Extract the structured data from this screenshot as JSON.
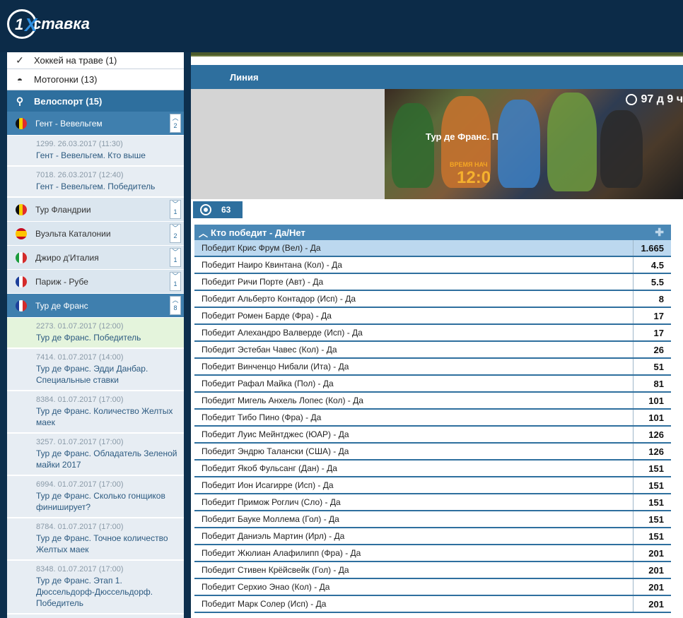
{
  "header": {
    "logo_one": "1",
    "logo_x": "X",
    "logo_text": "ставка"
  },
  "sidebar": {
    "sports": [
      {
        "label": "Хоккей на траве (1)",
        "icon": "hockey-stick-icon"
      },
      {
        "label": "Мотогонки (13)",
        "icon": "motorcycle-icon"
      }
    ],
    "active_sport": {
      "label": "Велоспорт (15)",
      "icon": "bicycle-icon"
    },
    "leagues": [
      {
        "label": "Гент - Вевельгем",
        "count": "2",
        "flag": "belgium"
      },
      {
        "label": "Тур Фландрии",
        "count": "1",
        "flag": "belgium"
      },
      {
        "label": "Вуэльта Каталонии",
        "count": "2",
        "flag": "spain"
      },
      {
        "label": "Джиро д'Италия",
        "count": "1",
        "flag": "italy"
      },
      {
        "label": "Париж - Рубе",
        "count": "1",
        "flag": "france"
      },
      {
        "label": "Тур де Франс",
        "count": "8",
        "flag": "france"
      }
    ],
    "gent_events": [
      {
        "meta": "1299. 26.03.2017 (11:30)",
        "title": "Гент - Вевельгем. Кто выше"
      },
      {
        "meta": "7018. 26.03.2017 (12:40)",
        "title": "Гент - Вевельгем. Победитель"
      }
    ],
    "tour_events": [
      {
        "meta": "2273. 01.07.2017 (12:00)",
        "title": "Тур де Франс. Победитель"
      },
      {
        "meta": "7414. 01.07.2017 (14:00)",
        "title": "Тур де Франс. Эдди Данбар. Специальные ставки"
      },
      {
        "meta": "8384. 01.07.2017 (17:00)",
        "title": "Тур де Франс. Количество Желтых маек"
      },
      {
        "meta": "3257. 01.07.2017 (17:00)",
        "title": "Тур де Франс. Обладатель Зеленой майки 2017"
      },
      {
        "meta": "6994. 01.07.2017 (17:00)",
        "title": "Тур де Франс. Сколько гонщиков финиширует?"
      },
      {
        "meta": "8784. 01.07.2017 (17:00)",
        "title": "Тур де Франс. Точное количество Желтых маек"
      },
      {
        "meta": "8348. 01.07.2017 (17:00)",
        "title": "Тур де Франс. Этап 1. Дюссельдорф-Дюссельдорф. Победитель"
      }
    ]
  },
  "main": {
    "line_label": "Линия",
    "banner": {
      "countdown": "97 д 9 ч",
      "title": "Тур де Франс. П",
      "start_label": "ВРЕМЯ НАЧ",
      "start_time": "12:0"
    },
    "markets_count": "63",
    "market": {
      "title": "Кто победит - Да/Нет",
      "rows": [
        {
          "name": "Победит Крис Фрум (Вел) - Да",
          "odd": "1.665"
        },
        {
          "name": "Победит Наиро Квинтана (Кол) - Да",
          "odd": "4.5"
        },
        {
          "name": "Победит Ричи Порте (Авт) - Да",
          "odd": "5.5"
        },
        {
          "name": "Победит Альберто Контадор (Исп) - Да",
          "odd": "8"
        },
        {
          "name": "Победит Ромен Барде (Фра) - Да",
          "odd": "17"
        },
        {
          "name": "Победит Алехандро Валверде (Исп) - Да",
          "odd": "17"
        },
        {
          "name": "Победит Эстебан Чавес (Кол) - Да",
          "odd": "26"
        },
        {
          "name": "Победит Винченцо Нибали (Ита) - Да",
          "odd": "51"
        },
        {
          "name": "Победит Рафал Майка (Пол) - Да",
          "odd": "81"
        },
        {
          "name": "Победит Мигель Анхель Лопес (Кол) - Да",
          "odd": "101"
        },
        {
          "name": "Победит Тибо Пино (Фра) - Да",
          "odd": "101"
        },
        {
          "name": "Победит Луис Мейнтджес (ЮАР) - Да",
          "odd": "126"
        },
        {
          "name": "Победит Эндрю Талански (США) - Да",
          "odd": "126"
        },
        {
          "name": "Победит Якоб Фульсанг (Дан) - Да",
          "odd": "151"
        },
        {
          "name": "Победит Ион Исагирре (Исп) - Да",
          "odd": "151"
        },
        {
          "name": "Победит Примож Роглич (Сло) - Да",
          "odd": "151"
        },
        {
          "name": "Победит Бауке Моллема (Гол) - Да",
          "odd": "151"
        },
        {
          "name": "Победит Даниэль Мартин (Ирл) - Да",
          "odd": "151"
        },
        {
          "name": "Победит Жюлиан Алафилипп (Фра) - Да",
          "odd": "201"
        },
        {
          "name": "Победит Стивен Крёйсвейк (Гол) - Да",
          "odd": "201"
        },
        {
          "name": "Победит Серхио Энао (Кол) - Да",
          "odd": "201"
        },
        {
          "name": "Победит Марк Солер (Исп) - Да",
          "odd": "201"
        }
      ]
    }
  },
  "colors": {
    "header_bg": "#0c2b48",
    "accent": "#2e6f9e",
    "market_head": "#4a88b6",
    "selected_row": "#bcd8ef",
    "highlight_event": "#e4f4dc"
  }
}
